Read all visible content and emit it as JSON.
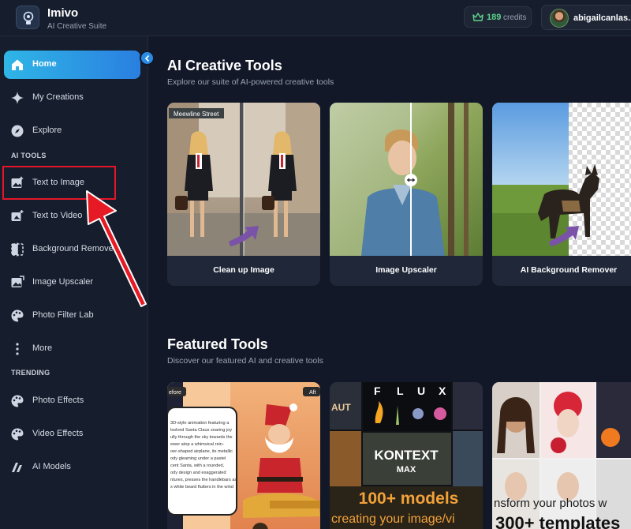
{
  "app": {
    "name": "Imivo",
    "subtitle": "AI Creative Suite"
  },
  "header": {
    "credits_count": "189",
    "credits_label": "credits",
    "username": "abigailcanlas..."
  },
  "sidebar": {
    "items": [
      {
        "label": "Home",
        "icon": "home-icon",
        "active": true
      },
      {
        "label": "My Creations",
        "icon": "sparkle-icon"
      },
      {
        "label": "Explore",
        "icon": "compass-icon"
      }
    ],
    "ai_tools_label": "AI TOOLS",
    "ai_tools": [
      {
        "label": "Text to Image",
        "icon": "image-plus-icon"
      },
      {
        "label": "Text to Video",
        "icon": "video-plus-icon"
      },
      {
        "label": "Background Remover",
        "icon": "split-frame-icon"
      },
      {
        "label": "Image Upscaler",
        "icon": "image-upscale-icon"
      },
      {
        "label": "Photo Filter Lab",
        "icon": "filter-palette-icon"
      },
      {
        "label": "More",
        "icon": "more-vertical-icon"
      }
    ],
    "trending_label": "TRENDING",
    "trending": [
      {
        "label": "Photo Effects",
        "icon": "effects-palette-icon"
      },
      {
        "label": "Video Effects",
        "icon": "video-effects-icon"
      },
      {
        "label": "AI Models",
        "icon": "models-icon"
      }
    ]
  },
  "main": {
    "creative": {
      "title": "AI Creative Tools",
      "subtitle": "Explore our suite of AI-powered creative tools",
      "cards": [
        {
          "label": "Clean up Image",
          "street_sign": "Meewline Street"
        },
        {
          "label": "Image Upscaler"
        },
        {
          "label": "AI Background Remover"
        }
      ]
    },
    "featured": {
      "title": "Featured Tools",
      "subtitle": "Discover our featured AI and creative tools",
      "cards": [
        {
          "badge_before": "efore",
          "badge_after": "Aft",
          "note_lines": [
            "3D-style animation featuring a",
            "lsolved Santa Claus soaring joy",
            "ully through the sky towards the",
            "ewer atop a whimsical rein-",
            "oer-shaped airplane, its metallic",
            "ody gleaming under a pastel",
            "cent Santa, with a rounded,",
            "ody design and exaggerated",
            "ntures, presses the handlebars as",
            "s white beard flutters in the wind"
          ]
        },
        {
          "flux_letters": [
            "F",
            "L",
            "U",
            "X"
          ],
          "left_tag": "AUT",
          "kontext": "KONTEXT",
          "max": "MAX",
          "models_line": "100+ models",
          "creating_line": "creating your image/vi"
        },
        {
          "transform_line": "nsform your photos w",
          "templates_line": "300+ templates"
        }
      ]
    }
  },
  "colors": {
    "accent": "#2a8be6",
    "credits_green": "#5fd38a",
    "highlight_red": "#e5162a",
    "background": "#121827",
    "panel": "#161d2c"
  }
}
